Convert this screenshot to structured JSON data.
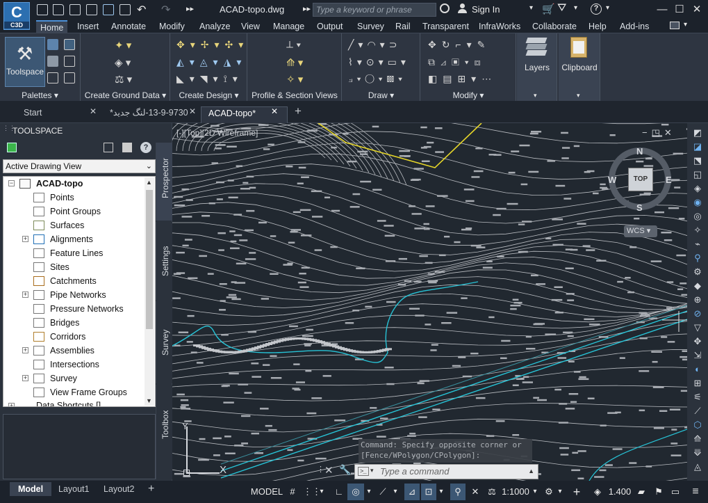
{
  "app": {
    "logo_text": "C",
    "logo_sub": "C3D",
    "doc_title": "ACAD-topo.dwg"
  },
  "search": {
    "placeholder": "Type a keyword or phrase"
  },
  "account": {
    "signin_label": "Sign In"
  },
  "ribbon_tabs": [
    "Home",
    "Insert",
    "Annotate",
    "Modify",
    "Analyze",
    "View",
    "Manage",
    "Output",
    "Survey",
    "Rail",
    "Transparent",
    "InfraWorks",
    "Collaborate",
    "Help",
    "Add-ins"
  ],
  "ribbon_panels": {
    "toolspace_label": "Toolspace",
    "palettes": "Palettes",
    "create_ground_data": "Create Ground Data",
    "create_design": "Create Design",
    "profile_section_views": "Profile & Section Views",
    "draw": "Draw",
    "modify": "Modify",
    "layers": "Layers",
    "clipboard": "Clipboard"
  },
  "doc_tabs": {
    "start": "Start",
    "tab2": "13-9-9730-لنگ جدید*",
    "tab3": "ACAD-topo*"
  },
  "toolspace": {
    "header": "TOOLSPACE",
    "view_combo": "Active Drawing View",
    "tree_root": "ACAD-topo",
    "items": [
      "Points",
      "Point Groups",
      "Surfaces",
      "Alignments",
      "Feature Lines",
      "Sites",
      "Catchments",
      "Pipe Networks",
      "Pressure Networks",
      "Bridges",
      "Corridors",
      "Assemblies",
      "Intersections",
      "Survey",
      "View Frame Groups"
    ],
    "data_shortcuts": "Data Shortcuts []",
    "vertical_tabs": [
      "Prospector",
      "Settings",
      "Survey",
      "Toolbox"
    ]
  },
  "viewport": {
    "label": "[-][Top][2D Wireframe]",
    "viewcube_top": "TOP",
    "compass": {
      "n": "N",
      "s": "S",
      "e": "E",
      "w": "W"
    },
    "wcs": "WCS",
    "ucs_x": "X",
    "ucs_y": "Y"
  },
  "command": {
    "history_line1": "Command: Specify opposite corner or",
    "history_line2": "[Fence/WPolygon/CPolygon]:",
    "placeholder": "Type a command"
  },
  "status": {
    "layout_tabs": [
      "Model",
      "Layout1",
      "Layout2"
    ],
    "model_label": "MODEL",
    "scale": "1:1000",
    "value": "1.400"
  },
  "colors": {
    "title_bg": "#1c222b",
    "ribbon_bg": "#2e3541",
    "canvas_bg": "#212830",
    "accent": "#4b8fd6",
    "cyan_line": "#27c3d6",
    "yellow_line": "#e6d629",
    "contour": "#b9bcc1"
  }
}
